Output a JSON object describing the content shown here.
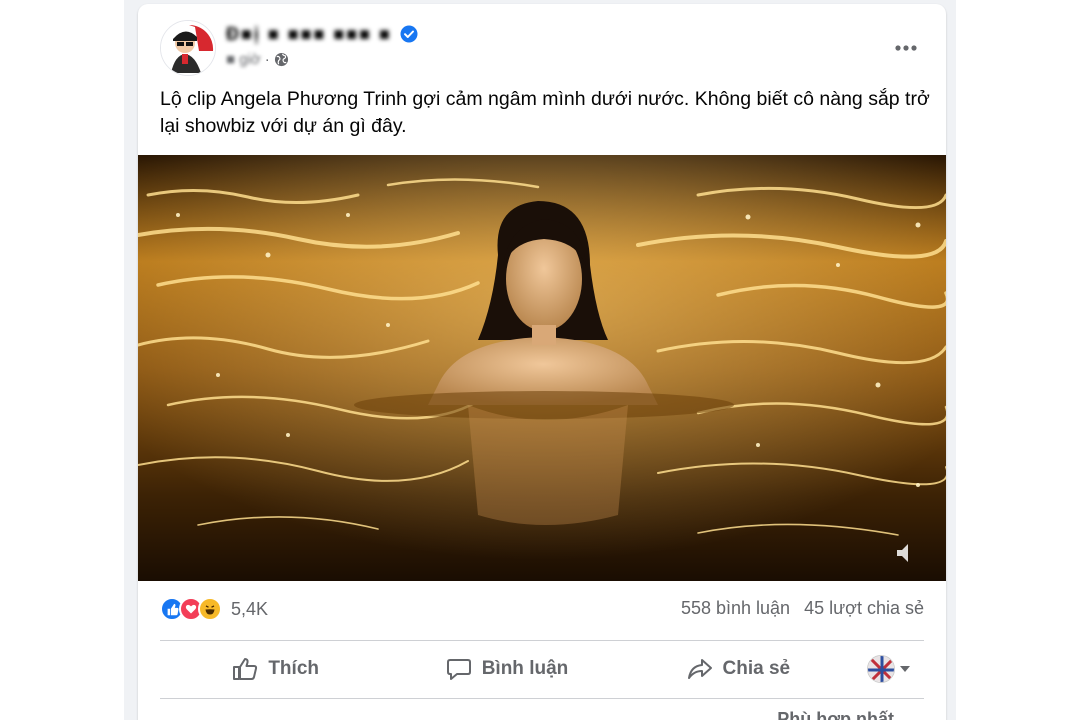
{
  "post": {
    "author_name": "Đ■ị ■ ■■■ ■■■ ■",
    "time_label": "■ giờ",
    "audience": "globe-icon",
    "text": "Lộ clip Angela Phương Trinh gợi cảm ngâm mình dưới nước. Không biết cô nàng sắp trở lại showbiz với dự án gì đây."
  },
  "stats": {
    "reactions_count": "5,4K",
    "reaction_types": [
      "like-icon",
      "love-icon",
      "haha-icon"
    ],
    "comments": "558 bình luận",
    "shares": "45 lượt chia sẻ"
  },
  "actions": {
    "like": "Thích",
    "comment": "Bình luận",
    "share": "Chia sẻ"
  },
  "comments_sort": "Phù hợp nhất",
  "colors": {
    "facebook_blue": "#1877f2",
    "love_red": "#f33e58",
    "haha_yellow": "#f7b928",
    "secondary_text": "#65676b",
    "water_gold": "#c8841c"
  }
}
